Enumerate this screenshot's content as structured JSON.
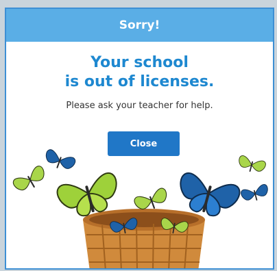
{
  "dialog": {
    "title": "Sorry!",
    "headline_line1": "Your school",
    "headline_line2": "is out of licenses.",
    "message": "Please ask your teacher for help.",
    "close_label": "Close"
  },
  "illustration": {
    "icon": "butterflies-basket-illustration"
  },
  "colors": {
    "header": "#5aaee6",
    "headline": "#1e88d0",
    "button": "#2077c7",
    "border": "#3d8fd4"
  }
}
